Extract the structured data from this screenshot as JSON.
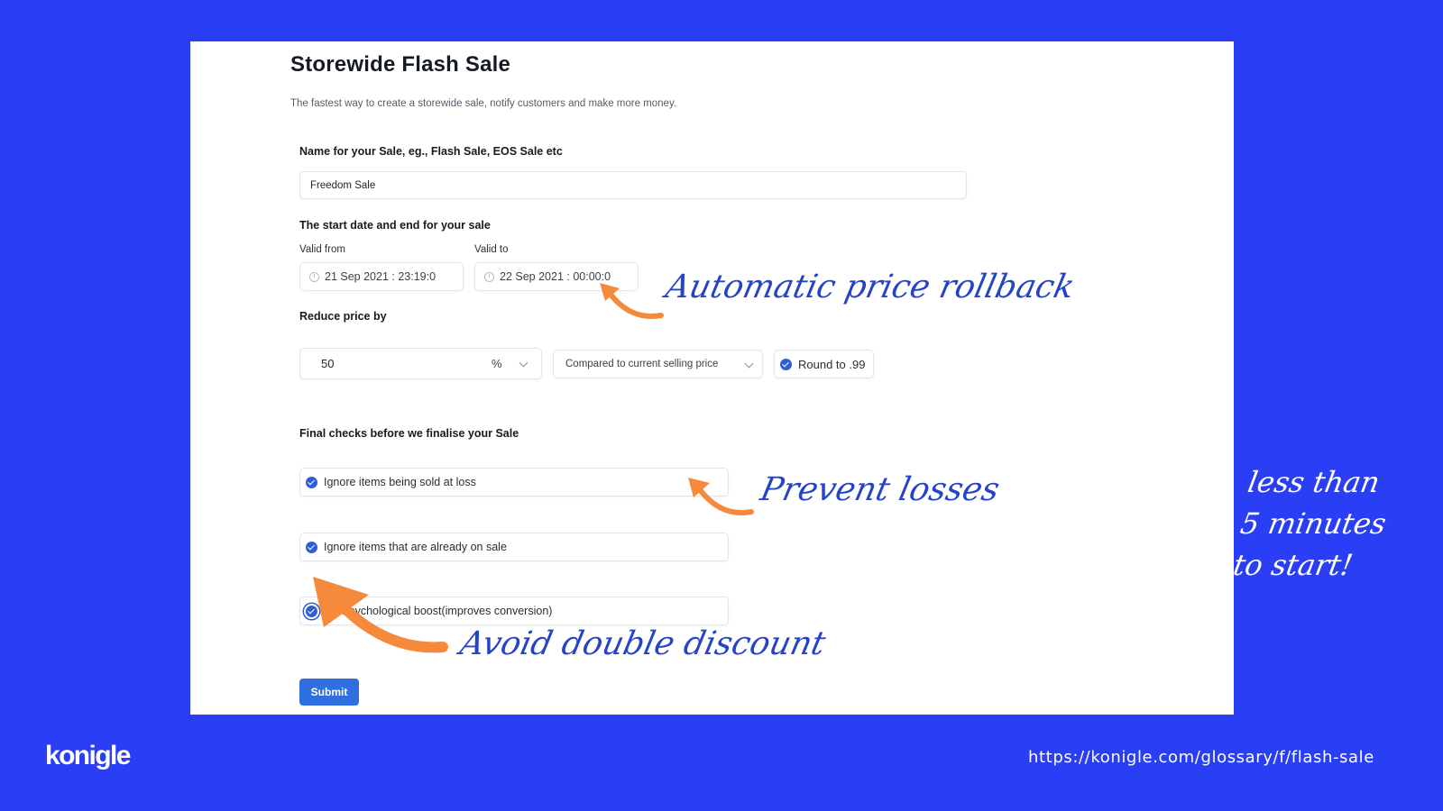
{
  "colors": {
    "background": "#2a3ef5",
    "primary": "#2f6fe0",
    "checkbox": "#2f5fd6",
    "annotation_text": "#2543c8",
    "annotation_arrow": "#f58a3d"
  },
  "form": {
    "title": "Storewide Flash Sale",
    "subtitle": "The fastest way to create a storewide sale, notify customers and make more money.",
    "name_section": {
      "label": "Name for your Sale, eg., Flash Sale, EOS Sale etc",
      "value": "Freedom Sale"
    },
    "date_section": {
      "label": "The start date and end for your sale",
      "valid_from_label": "Valid from",
      "valid_from_value": "21 Sep 2021 : 23:19:0",
      "valid_to_label": "Valid to",
      "valid_to_value": "22 Sep 2021 : 00:00:0"
    },
    "reduce_section": {
      "label": "Reduce price by",
      "amount": "50",
      "unit": "%",
      "compare_option": "Compared to current selling price",
      "round_label": "Round to .99",
      "round_checked": true
    },
    "final_checks": {
      "label": "Final checks before we finalise your Sale",
      "items": [
        {
          "label": "Ignore items being sold at loss",
          "checked": true
        },
        {
          "label": "Ignore items that are already on sale",
          "checked": true
        },
        {
          "label": "Psychological boost(improves conversion)",
          "checked": true
        }
      ]
    },
    "submit_label": "Submit"
  },
  "annotations": {
    "rollback": "Automatic price rollback",
    "losses": "Prevent losses",
    "double_discount": "Avoid double discount",
    "side_note_lines": [
      "less than",
      "5 minutes",
      "to start!"
    ]
  },
  "footer": {
    "logo": "konigle",
    "url": "https://konigle.com/glossary/f/flash-sale"
  }
}
